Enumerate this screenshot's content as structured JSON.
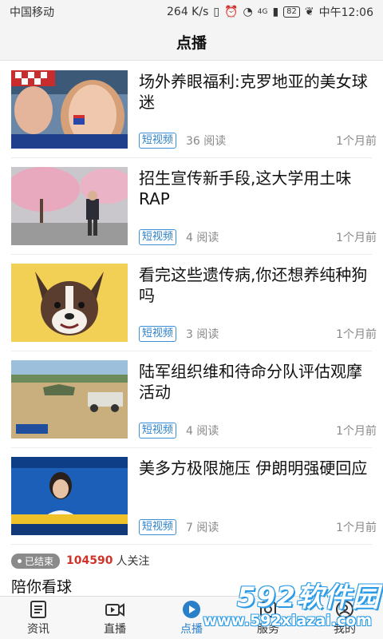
{
  "status_bar": {
    "carrier": "中国移动",
    "net_speed": "264 K/s",
    "network": "4G",
    "battery": "82",
    "time": "中午12:06"
  },
  "header": {
    "title": "点播"
  },
  "feed": [
    {
      "title": "场外养眼福利:克罗地亚的美女球迷",
      "tag": "短视频",
      "reads": "36 阅读",
      "date": "1个月前",
      "thumb": "fans"
    },
    {
      "title": "招生宣传新手段,这大学用土味RAP",
      "tag": "短视频",
      "reads": "4 阅读",
      "date": "1个月前",
      "thumb": "cherry"
    },
    {
      "title": "看完这些遗传病,你还想养纯种狗吗",
      "tag": "短视频",
      "reads": "3 阅读",
      "date": "1个月前",
      "thumb": "dog"
    },
    {
      "title": "陆军组织维和待命分队评估观摩活动",
      "tag": "短视频",
      "reads": "4 阅读",
      "date": "1个月前",
      "thumb": "army"
    },
    {
      "title": "美多方极限施压 伊朗明强硬回应",
      "tag": "短视频",
      "reads": "7 阅读",
      "date": "1个月前",
      "thumb": "news"
    }
  ],
  "live": {
    "badge": "已结束",
    "followers": "104590",
    "followers_suffix": "人关注",
    "title": "陪你看球"
  },
  "tabs": [
    {
      "label": "资讯",
      "icon": "news-icon"
    },
    {
      "label": "直播",
      "icon": "video-camera-icon"
    },
    {
      "label": "点播",
      "icon": "play-icon",
      "active": true
    },
    {
      "label": "服务",
      "icon": "service-icon"
    },
    {
      "label": "我的",
      "icon": "profile-icon"
    }
  ],
  "watermark": {
    "brand": "592软件园",
    "url": "www.592xiazai.com"
  },
  "colors": {
    "accent": "#2a7fc9",
    "followers": "#d1332b"
  }
}
